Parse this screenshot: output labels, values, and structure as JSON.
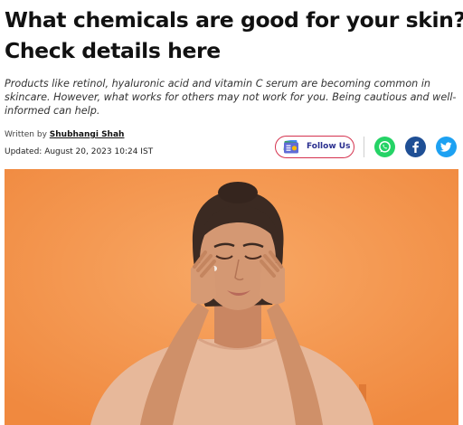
{
  "article": {
    "title_line1": "What chemicals are good for your skin?",
    "title_line2": "Check details here",
    "summary": "Products like retinol, hyaluronic acid and vitamin C serum are becoming common in skincare. However, what works for others may not work for you. Being cautious and well-informed can help.",
    "written_by_label": "Written by",
    "author": "Shubhangi Shah",
    "updated": "Updated: August 20, 2023 10:24 IST"
  },
  "share": {
    "follow_label": "Follow Us",
    "icons": [
      "google-news-icon",
      "whatsapp-icon",
      "facebook-icon",
      "twitter-icon"
    ]
  },
  "colors": {
    "hero_background": "#f4974e",
    "follow_border": "#d5334f",
    "follow_text": "#2a2f8f",
    "whatsapp": "#25d366",
    "facebook": "#1f4f95",
    "twitter": "#1da1f2"
  }
}
